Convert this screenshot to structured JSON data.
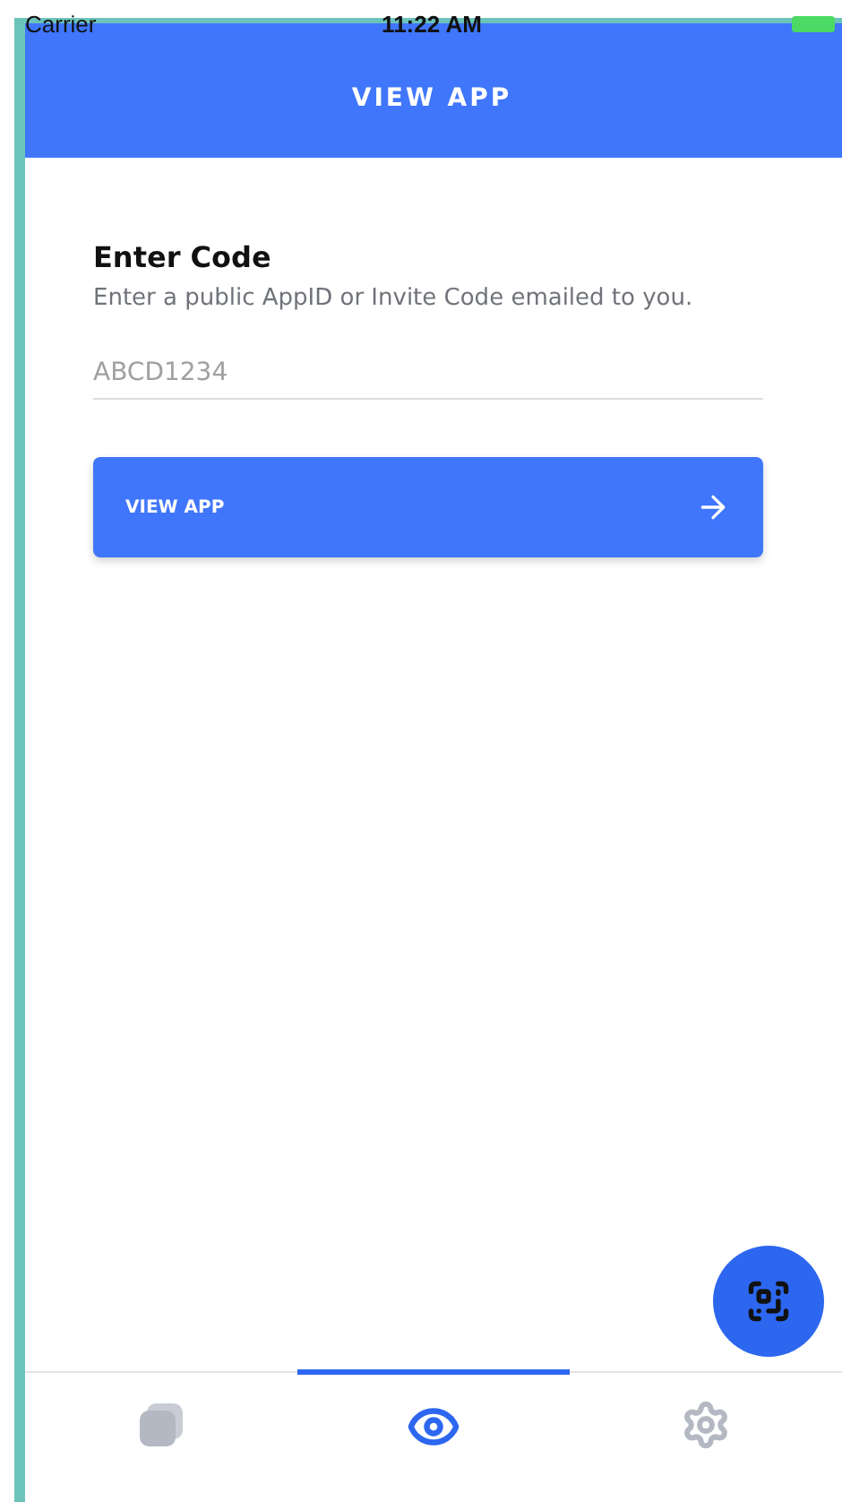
{
  "status_bar": {
    "carrier": "Carrier",
    "time": "11:22 AM"
  },
  "header": {
    "title": "VIEW APP"
  },
  "form": {
    "heading": "Enter Code",
    "description": "Enter a public AppID or Invite Code emailed to you.",
    "code_field": {
      "placeholder": "ABCD1234"
    },
    "submit_button": "VIEW APP"
  },
  "tabs": [
    {
      "kind": "apps",
      "selected": false
    },
    {
      "kind": "view",
      "selected": true
    },
    {
      "kind": "settings",
      "selected": false
    }
  ]
}
